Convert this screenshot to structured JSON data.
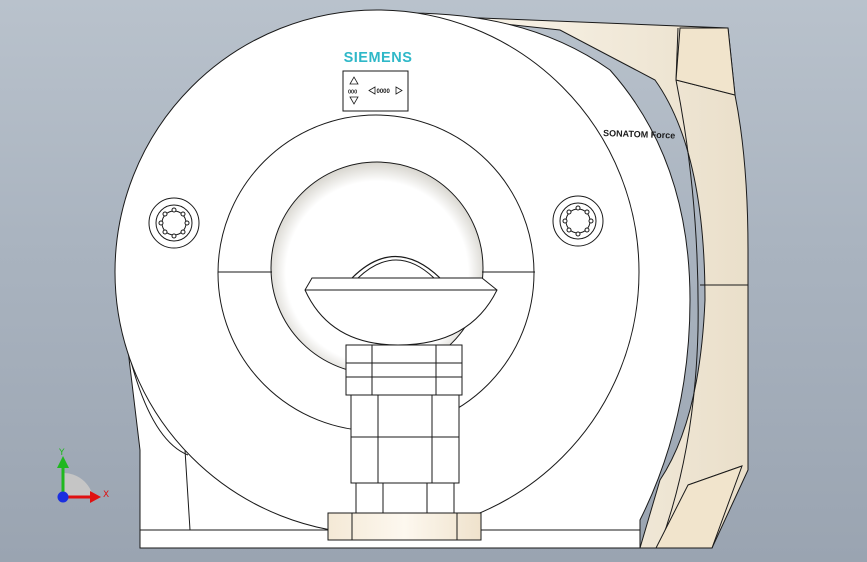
{
  "model": {
    "brand_text": "SIEMENS",
    "model_text": "SONATOM Force",
    "panel_left_value": "000",
    "panel_right_value": "0000"
  },
  "triad": {
    "x_label": "X",
    "y_label": "Y"
  },
  "colors": {
    "background_top": "#b9c2cc",
    "background_bottom": "#9aa4b1",
    "body_fill": "#ffffff",
    "side_fill": "#f3ead9",
    "edge": "#1a1a1a",
    "brand": "#2fb8c8",
    "axis_x": "#e01010",
    "axis_y": "#1fb81f",
    "axis_z": "#1a2fe0"
  },
  "icons": {
    "triad": "coordinate-triad-icon",
    "bolt": "bolt-circle-icon",
    "arrow_up": "triangle-up-icon",
    "arrow_down": "triangle-down-icon",
    "arrow_left": "triangle-left-icon",
    "arrow_right": "triangle-right-icon"
  }
}
